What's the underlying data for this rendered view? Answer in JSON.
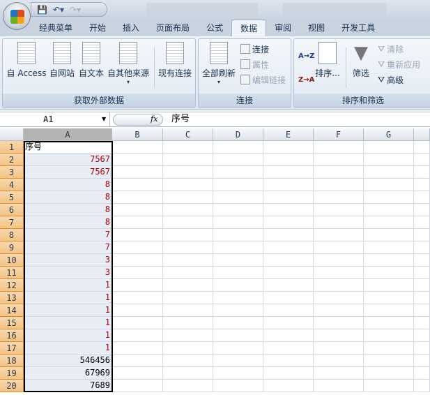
{
  "quick_access": {
    "save": "save-icon",
    "undo": "undo-icon",
    "redo": "redo-icon"
  },
  "tabs": [
    "经典菜单",
    "开始",
    "插入",
    "页面布局",
    "公式",
    "数据",
    "审阅",
    "视图",
    "开发工具"
  ],
  "active_tab": "数据",
  "ribbon": {
    "get_external": {
      "label": "获取外部数据",
      "access": "自 Access",
      "web": "自网站",
      "text": "自文本",
      "other": "自其他来源",
      "existing": "现有连接"
    },
    "connections": {
      "label": "连接",
      "refresh_all": "全部刷新",
      "connections": "连接",
      "properties": "属性",
      "edit_links": "编辑链接"
    },
    "sort_filter": {
      "label": "排序和筛选",
      "sort": "排序...",
      "filter": "筛选",
      "clear": "清除",
      "reapply": "重新应用",
      "advanced": "高级",
      "sort_az": "A→Z",
      "sort_za": "Z→A"
    }
  },
  "formula_bar": {
    "name_box": "A1",
    "fx": "fx",
    "value": "序号"
  },
  "columns": [
    "A",
    "B",
    "C",
    "D",
    "E",
    "F",
    "G"
  ],
  "rows": [
    {
      "n": "1",
      "a": "序号",
      "red": false
    },
    {
      "n": "2",
      "a": "7567",
      "red": true
    },
    {
      "n": "3",
      "a": "7567",
      "red": true
    },
    {
      "n": "4",
      "a": "8",
      "red": true
    },
    {
      "n": "5",
      "a": "8",
      "red": true
    },
    {
      "n": "6",
      "a": "8",
      "red": true
    },
    {
      "n": "7",
      "a": "8",
      "red": true
    },
    {
      "n": "8",
      "a": "7",
      "red": true
    },
    {
      "n": "9",
      "a": "7",
      "red": true
    },
    {
      "n": "10",
      "a": "3",
      "red": true
    },
    {
      "n": "11",
      "a": "3",
      "red": true
    },
    {
      "n": "12",
      "a": "1",
      "red": true
    },
    {
      "n": "13",
      "a": "1",
      "red": true
    },
    {
      "n": "14",
      "a": "1",
      "red": true
    },
    {
      "n": "15",
      "a": "1",
      "red": true
    },
    {
      "n": "16",
      "a": "1",
      "red": true
    },
    {
      "n": "17",
      "a": "1",
      "red": true
    },
    {
      "n": "18",
      "a": "546456",
      "red": false
    },
    {
      "n": "19",
      "a": "67969",
      "red": false
    },
    {
      "n": "20",
      "a": "7689",
      "red": false
    }
  ],
  "colors": {
    "red_text": "#b00000",
    "selection_header": "#f3c384"
  }
}
